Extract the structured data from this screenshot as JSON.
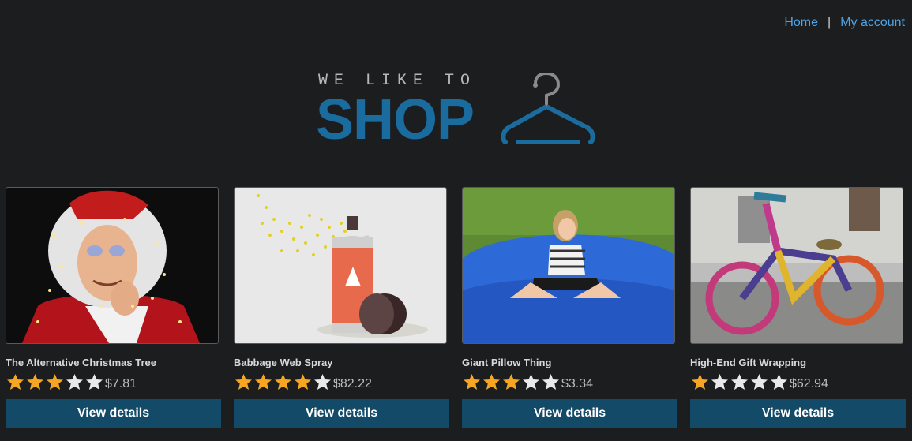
{
  "nav": {
    "home_label": "Home",
    "separator": "|",
    "account_label": "My account"
  },
  "logo": {
    "tagline": "WE LIKE TO",
    "word": "SHOP",
    "icon": "hanger-icon"
  },
  "colors": {
    "background": "#1c1d1f",
    "link": "#4ea4e8",
    "brand": "#1b6c9e",
    "button": "#124a68",
    "star_filled": "#f5a623",
    "star_empty": "#e9e9e9"
  },
  "products": [
    {
      "title": "The Alternative Christmas Tree",
      "rating": 3,
      "max_rating": 5,
      "price": "$7.81",
      "button_label": "View details",
      "image": "santa-with-lights-image"
    },
    {
      "title": "Babbage Web Spray",
      "rating": 4,
      "max_rating": 5,
      "price": "$82.22",
      "button_label": "View details",
      "image": "spray-can-image"
    },
    {
      "title": "Giant Pillow Thing",
      "rating": 3,
      "max_rating": 5,
      "price": "$3.34",
      "button_label": "View details",
      "image": "girl-on-giant-pillow-image"
    },
    {
      "title": "High-End Gift Wrapping",
      "rating": 1,
      "max_rating": 5,
      "price": "$62.94",
      "button_label": "View details",
      "image": "yarn-wrapped-bicycle-image"
    }
  ]
}
